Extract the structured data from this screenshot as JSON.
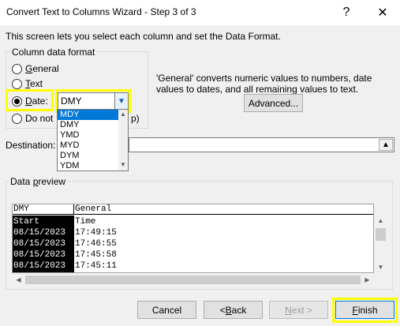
{
  "window": {
    "title": "Convert Text to Columns Wizard - Step 3 of 3",
    "help_label": "?",
    "close_label": "✕"
  },
  "intro": "This screen lets you select each column and set the Data Format.",
  "column_format": {
    "legend": "Column data format",
    "options": {
      "general": "General",
      "text": "Text",
      "date": "Date:",
      "donot_head": "Do not",
      "donot_tail": "p)"
    },
    "selected": "date",
    "date_value": "DMY",
    "date_options": [
      "MDY",
      "DMY",
      "YMD",
      "MYD",
      "DYM",
      "YDM"
    ],
    "highlighted_option": "MDY"
  },
  "info_text": "'General' converts numeric values to numbers, date values to dates, and all remaining values to text.",
  "advanced_label": "Advanced...",
  "destination": {
    "label": "Destination:",
    "value": ""
  },
  "preview": {
    "legend": "Data preview",
    "headers": [
      "DMY",
      "General"
    ],
    "rows": [
      [
        "Start",
        "Time"
      ],
      [
        "08/15/2023",
        "17:49:15"
      ],
      [
        "08/15/2023",
        "17:46:55"
      ],
      [
        "08/15/2023",
        "17:45:58"
      ],
      [
        "08/15/2023",
        "17:45:11"
      ]
    ]
  },
  "buttons": {
    "cancel": "Cancel",
    "back_underlined": "B",
    "back_rest": "ack",
    "back_prefix": "< ",
    "next_rest": "ext >",
    "next_underlined": "N",
    "finish_underlined": "F",
    "finish_rest": "inish"
  },
  "colors": {
    "highlight": "#ffff00",
    "selection": "#0078d7"
  }
}
